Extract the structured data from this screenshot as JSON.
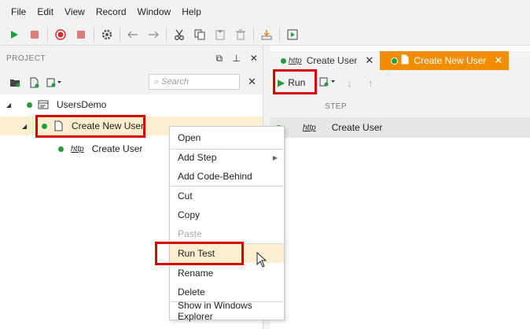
{
  "menu": [
    "File",
    "Edit",
    "View",
    "Record",
    "Window",
    "Help"
  ],
  "toolbar": {
    "icons": [
      "play-icon",
      "stop-icon",
      "record-icon",
      "stop-record-icon",
      "settings-icon",
      "undo-icon",
      "redo-icon",
      "cut-icon",
      "copy-icon",
      "paste-icon",
      "delete-icon",
      "export-icon",
      "run-window-icon"
    ]
  },
  "project_panel": {
    "title": "PROJECT",
    "search_placeholder": "Search",
    "tree": {
      "root": "UsersDemo",
      "child": "Create New User",
      "grandchild_badge": "http",
      "grandchild": "Create User"
    }
  },
  "tabs": [
    {
      "badge": "http",
      "label": "Create User",
      "active": false
    },
    {
      "label": "Create New User",
      "active": true
    }
  ],
  "editor": {
    "run_label": "Run",
    "column_step": "STEP",
    "rows": [
      {
        "badge": "http",
        "label": "Create User"
      }
    ]
  },
  "context_menu": {
    "open": "Open",
    "add_step": "Add Step",
    "add_code_behind": "Add Code-Behind",
    "cut": "Cut",
    "copy": "Copy",
    "paste": "Paste",
    "run_test": "Run Test",
    "rename": "Rename",
    "delete": "Delete",
    "show_in_explorer": "Show in Windows Explorer"
  },
  "colors": {
    "accent_tab": "#f28c00",
    "highlight": "#d80000",
    "status_green": "#1e9e3e"
  }
}
